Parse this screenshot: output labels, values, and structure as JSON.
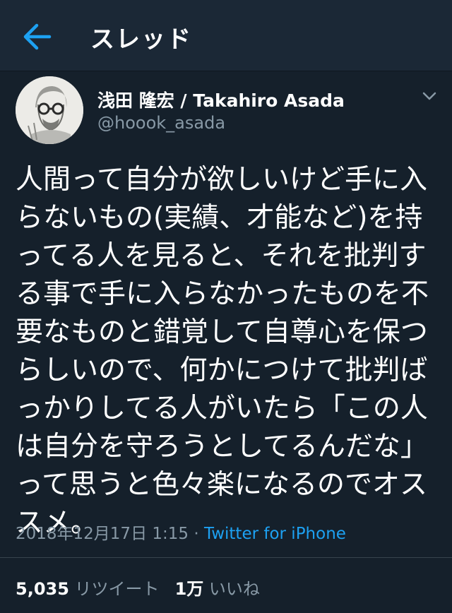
{
  "header": {
    "title": "スレッド"
  },
  "icons": {
    "back": "arrow-left-icon",
    "menu": "chevron-down-icon",
    "avatar": "user-avatar"
  },
  "colors": {
    "background": "#15202b",
    "header": "#1b2836",
    "accent": "#1da1f2",
    "secondary_text": "#8899a6"
  },
  "tweet": {
    "author_name": "浅田 隆宏 / Takahiro Asada",
    "author_handle": "@hoook_asada",
    "text": "人間って自分が欲しいけど手に入らないもの(実績、才能など)を持ってる人を見ると、それを批判する事で手に入らなかったものを不要なものと錯覚して自尊心を保つらしいので、何かにつけて批判ばっかりしてる人がいたら「この人は自分を守ろうとしてるんだな」って思うと色々楽になるのでオススメ。",
    "timestamp": "2018年12月17日 1:15",
    "separator": " · ",
    "source": "Twitter for iPhone",
    "retweet_count": "5,035",
    "retweet_label": "リツイート",
    "like_count": "1万",
    "like_label": "いいね"
  }
}
